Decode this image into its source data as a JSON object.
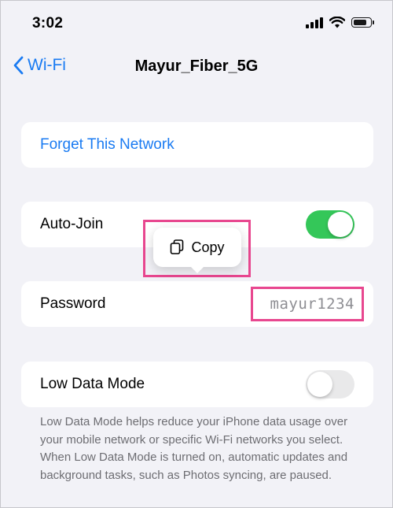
{
  "status_bar": {
    "time": "3:02",
    "icons": [
      "signal-icon",
      "wifi-icon",
      "battery-icon"
    ]
  },
  "nav": {
    "back_label": "Wi-Fi",
    "title": "Mayur_Fiber_5G"
  },
  "forget_network": {
    "label": "Forget This Network"
  },
  "auto_join": {
    "label": "Auto-Join",
    "enabled": true
  },
  "popover": {
    "copy_label": "Copy",
    "icon": "copy-icon"
  },
  "password": {
    "label": "Password",
    "value": "mayur1234"
  },
  "low_data_mode": {
    "label": "Low Data Mode",
    "enabled": false,
    "description": "Low Data Mode helps reduce your iPhone data usage over your mobile network or specific Wi-Fi networks you select. When Low Data Mode is turned on, automatic updates and background tasks, such as Photos syncing, are paused."
  },
  "colors": {
    "accent": "#1a7bf2",
    "toggle_on": "#34c759",
    "toggle_off": "#e9e9ea",
    "highlight": "#e8478f",
    "background": "#f2f2f7"
  }
}
